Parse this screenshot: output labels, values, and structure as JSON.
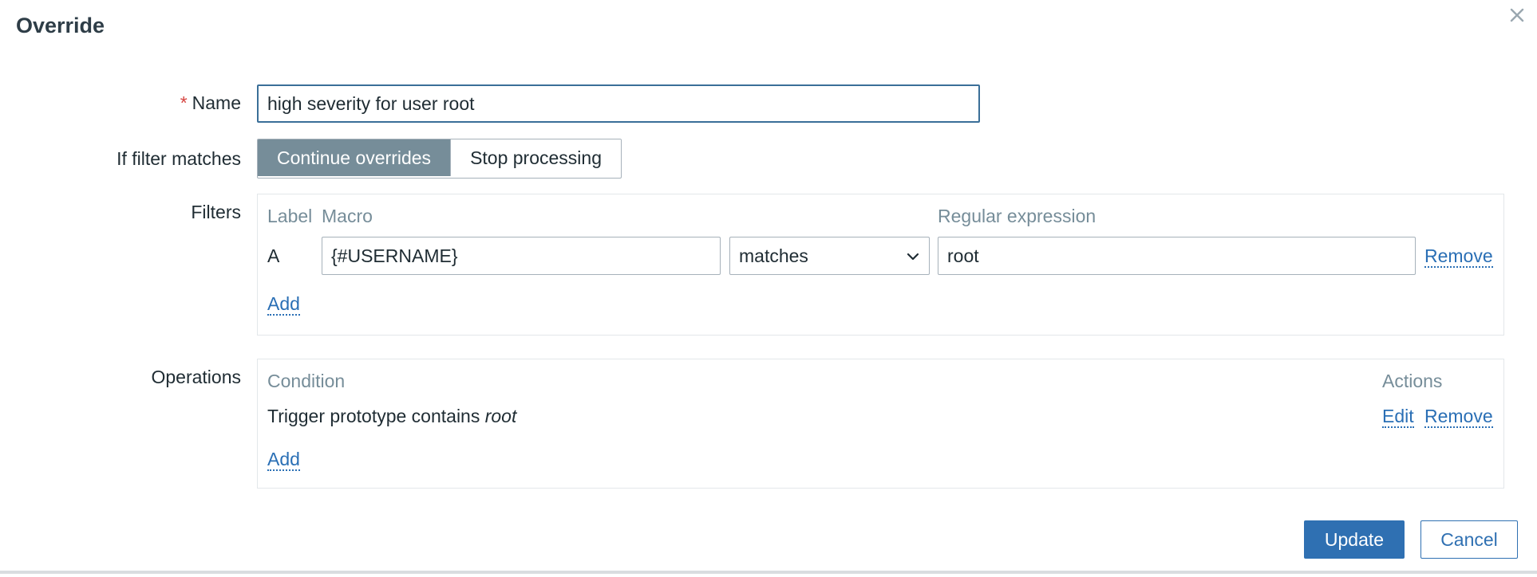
{
  "dialog": {
    "title": "Override",
    "close_icon": "close-icon"
  },
  "form": {
    "name": {
      "required_marker": "*",
      "label": "Name",
      "value": "high severity for user root"
    },
    "filter_match": {
      "label": "If filter matches",
      "options": [
        "Continue overrides",
        "Stop processing"
      ],
      "selected": "Continue overrides"
    },
    "filters": {
      "label": "Filters",
      "headers": {
        "label": "Label",
        "macro": "Macro",
        "regex": "Regular expression"
      },
      "rows": [
        {
          "label": "A",
          "macro": "{#USERNAME}",
          "operator": "matches",
          "regex": "root",
          "remove": "Remove"
        }
      ],
      "add": "Add"
    },
    "operations": {
      "label": "Operations",
      "headers": {
        "condition": "Condition",
        "actions": "Actions"
      },
      "rows": [
        {
          "condition_prefix": "Trigger prototype contains ",
          "condition_value": "root",
          "edit": "Edit",
          "remove": "Remove"
        }
      ],
      "add": "Add"
    }
  },
  "footer": {
    "update": "Update",
    "cancel": "Cancel"
  },
  "colors": {
    "primary": "#2f70b2",
    "segment_active": "#768d99",
    "required": "#d64541",
    "header_text": "#768d99"
  }
}
